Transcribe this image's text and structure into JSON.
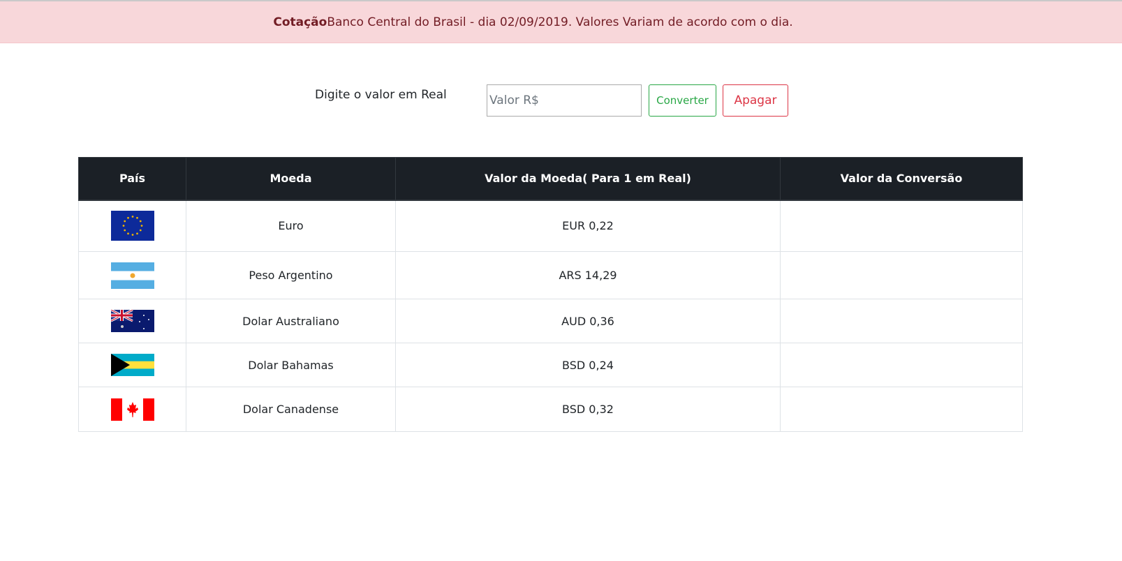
{
  "alert": {
    "strong": "Cotação",
    "text": "Banco Central do Brasil - dia 02/09/2019. Valores Variam de acordo com o dia."
  },
  "form": {
    "label": "Digite o valor em Real",
    "placeholder": "Valor R$",
    "value": "",
    "convert_label": "Converter",
    "clear_label": "Apagar"
  },
  "table": {
    "headers": [
      "País",
      "Moeda",
      "Valor da Moeda( Para 1 em Real)",
      "Valor da Conversão"
    ],
    "rows": [
      {
        "flag": "eu-flag-icon",
        "currency": "Euro",
        "rate": "EUR 0,22",
        "conversion": ""
      },
      {
        "flag": "argentina-flag-icon",
        "currency": "Peso Argentino",
        "rate": "ARS 14,29",
        "conversion": ""
      },
      {
        "flag": "australia-flag-icon",
        "currency": "Dolar Australiano",
        "rate": "AUD 0,36",
        "conversion": ""
      },
      {
        "flag": "bahamas-flag-icon",
        "currency": "Dolar Bahamas",
        "rate": "BSD 0,24",
        "conversion": ""
      },
      {
        "flag": "canada-flag-icon",
        "currency": "Dolar Canadense",
        "rate": "BSD 0,32",
        "conversion": ""
      }
    ]
  }
}
